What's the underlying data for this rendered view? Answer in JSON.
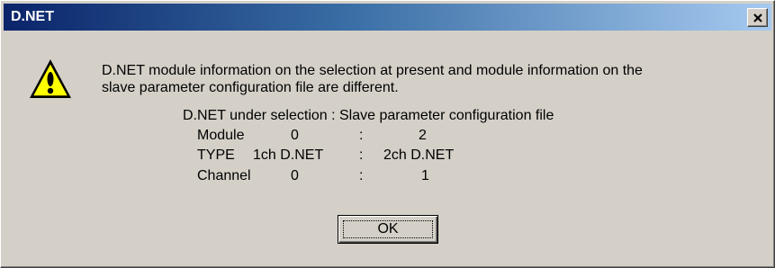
{
  "window": {
    "title": "D.NET",
    "close_label": "✕"
  },
  "dialog": {
    "icon": "warning-icon",
    "message_line1": "D.NET module information on the selection at present and module information on the",
    "message_line2": "slave parameter configuration file are different.",
    "compare_header": "D.NET under selection : Slave parameter configuration file",
    "rows": [
      {
        "label": "Module",
        "left": "0",
        "sep": ":",
        "right": "2"
      },
      {
        "label": "TYPE",
        "left": "1ch D.NET",
        "sep": ":",
        "right": "2ch D.NET"
      },
      {
        "label": "Channel",
        "left": "0",
        "sep": ":",
        "right": "1"
      }
    ]
  },
  "buttons": {
    "ok_label": "OK"
  }
}
